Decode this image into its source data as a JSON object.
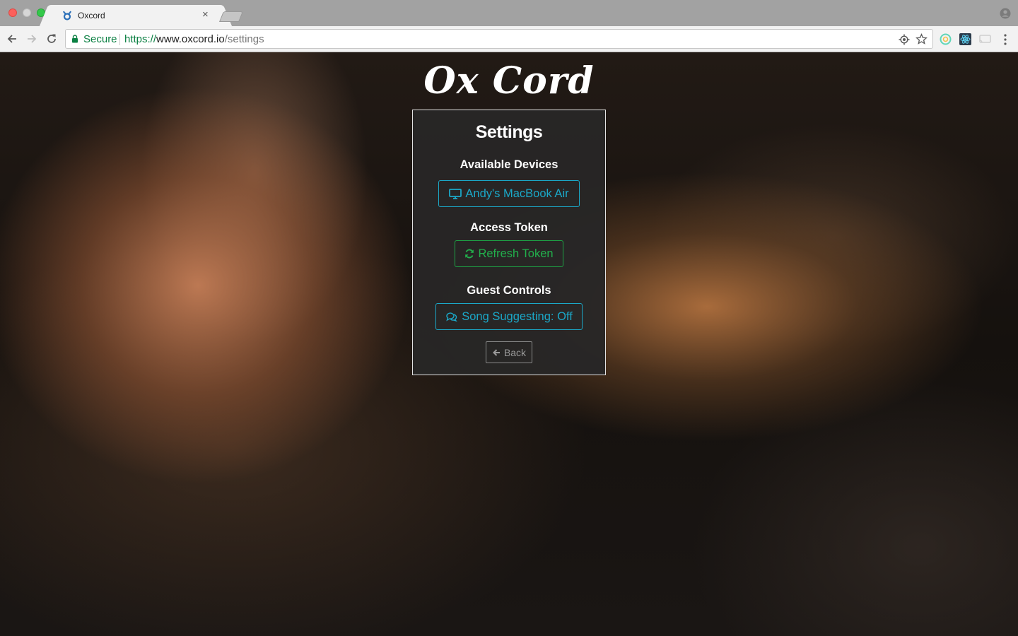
{
  "browser": {
    "tab": {
      "title": "Oxcord"
    },
    "omnibox": {
      "secure_label": "Secure",
      "url_scheme": "https://",
      "url_host": "www.oxcord.io",
      "url_path": "/settings"
    }
  },
  "page": {
    "logo": "Ox Cord",
    "settings": {
      "title": "Settings",
      "available_devices_label": "Available Devices",
      "device_button_label": "Andy's MacBook Air",
      "access_token_label": "Access Token",
      "refresh_button_label": "Refresh Token",
      "guest_controls_label": "Guest Controls",
      "song_suggesting_button_label": "Song Suggesting: Off",
      "back_button_label": "Back"
    }
  },
  "colors": {
    "accent_info": "#1ba8c8",
    "accent_success": "#22b04c",
    "secure_green": "#0b8043",
    "panel_bg": "#282626"
  },
  "icons": {
    "tab_favicon": "oxcord-logo-icon",
    "device_button": "desktop-icon",
    "refresh_button": "refresh-icon",
    "song_suggesting_button": "comments-icon",
    "back_button": "arrow-left-icon"
  }
}
